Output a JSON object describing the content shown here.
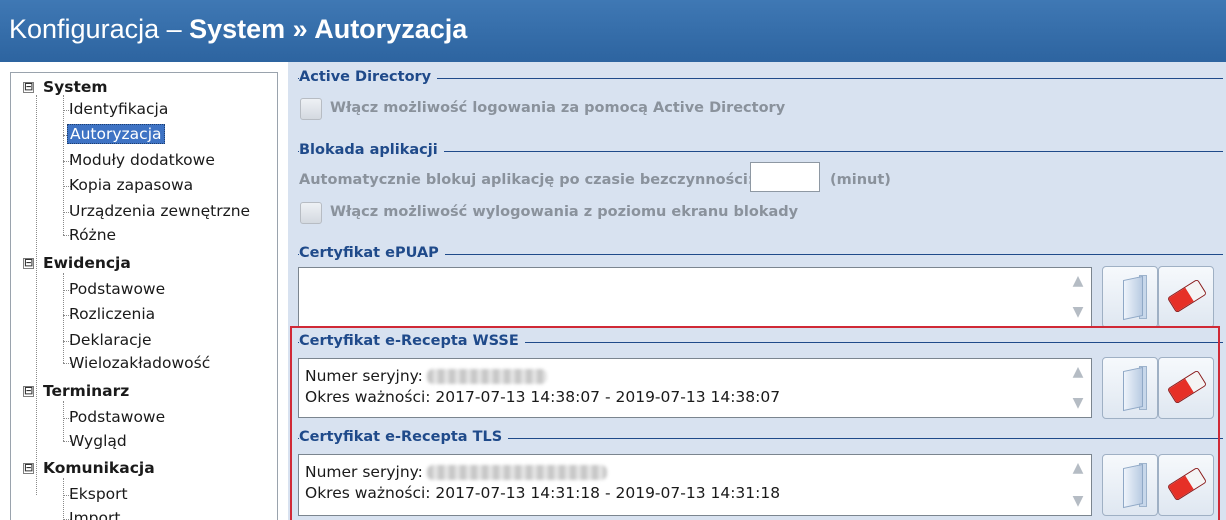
{
  "window": {
    "title_prefix": "Konfiguracja – ",
    "title_bold": "System » Autoryzacja"
  },
  "tree": {
    "groups": [
      {
        "label": "System",
        "expander": "⊟",
        "items": [
          "Identyfikacja",
          "Autoryzacja",
          "Moduły dodatkowe",
          "Kopia zapasowa",
          "Urządzenia zewnętrzne",
          "Różne"
        ]
      },
      {
        "label": "Ewidencja",
        "expander": "⊟",
        "items": [
          "Podstawowe",
          "Rozliczenia",
          "Deklaracje",
          "Wielozakładowość"
        ]
      },
      {
        "label": "Terminarz",
        "expander": "⊟",
        "items": [
          "Podstawowe",
          "Wygląd"
        ]
      },
      {
        "label": "Komunikacja",
        "expander": "⊟",
        "items": [
          "Eksport",
          "Import"
        ]
      }
    ],
    "selected": "Autoryzacja"
  },
  "active_directory": {
    "title": "Active Directory",
    "checkbox_label": "Włącz możliwość logowania za pomocą Active Directory",
    "checked": false
  },
  "lock": {
    "title": "Blokada aplikacji",
    "auto_lock_label": "Automatycznie blokuj aplikację po czasie bezczynności:",
    "auto_lock_value": "",
    "unit": "(minut)",
    "logout_label": "Włącz możliwość wylogowania z poziomu ekranu blokady",
    "logout_checked": false
  },
  "epuap": {
    "title": "Certyfikat ePUAP",
    "content": ""
  },
  "wsse": {
    "title": "Certyfikat e-Recepta WSSE",
    "serial_label": "Numer seryjny:",
    "validity": "Okres ważności: 2017-07-13 14:38:07 - 2019-07-13 14:38:07"
  },
  "tls": {
    "title": "Certyfikat e-Recepta TLS",
    "serial_label": "Numer seryjny:",
    "validity": "Okres ważności: 2017-07-13 14:31:18 - 2019-07-13 14:31:18"
  },
  "icons": {
    "load_button": "door-open-icon",
    "clear_button": "eraser-icon",
    "scroll_up": "▲",
    "scroll_down": "▼"
  },
  "colors": {
    "title_bar": "#2d64a0",
    "panel_background": "#d8e2f0",
    "group_title": "#1f4a8a",
    "highlight_border": "#d02936",
    "selected_item": "#3e73c4"
  }
}
